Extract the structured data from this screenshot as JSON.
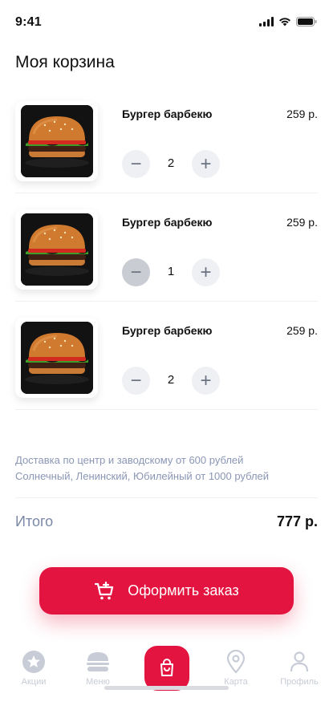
{
  "status": {
    "time": "9:41"
  },
  "page": {
    "title": "Моя корзина"
  },
  "items": [
    {
      "name": "Бургер барбекю",
      "price": "259 р.",
      "qty": "2",
      "minus_active": false
    },
    {
      "name": "Бургер барбекю",
      "price": "259 р.",
      "qty": "1",
      "minus_active": true
    },
    {
      "name": "Бургер барбекю",
      "price": "259 р.",
      "qty": "2",
      "minus_active": false
    }
  ],
  "stepper": {
    "minus": "−",
    "plus": "+"
  },
  "delivery": {
    "line1": "Доставка по центр и заводскому от 600 рублей",
    "line2": "Солнечный, Ленинский, Юбилейный от 1000 рублей"
  },
  "total": {
    "label": "Итого",
    "value": "777 р."
  },
  "checkout": {
    "label": "Оформить заказ"
  },
  "tabs": [
    {
      "label": "Акции",
      "icon": "star-icon"
    },
    {
      "label": "Меню",
      "icon": "burger-icon"
    },
    {
      "label": "",
      "icon": "cart-icon"
    },
    {
      "label": "Карта",
      "icon": "map-pin-icon"
    },
    {
      "label": "Профиль",
      "icon": "user-icon"
    }
  ],
  "colors": {
    "accent": "#e3143f",
    "muted_text": "#8a96b5",
    "tab_inactive": "#c7ccd6"
  }
}
